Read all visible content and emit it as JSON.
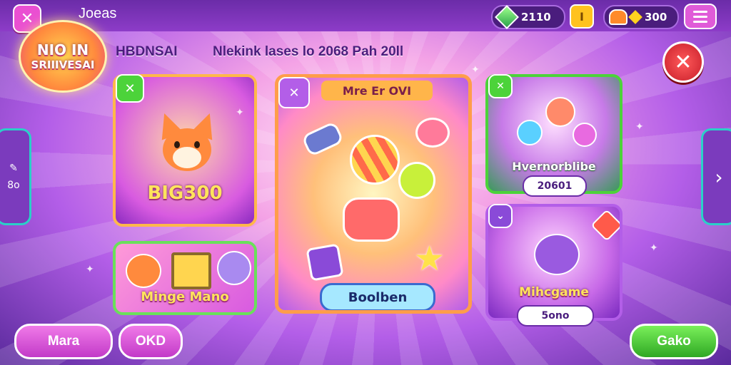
{
  "topbar": {
    "close_icon": "close-icon",
    "title": "Joeas",
    "gems_value": "2110",
    "coin_button_label": "I",
    "currency2_value": "300",
    "menu_icon": "hamburger-menu-icon"
  },
  "logo": {
    "line1": "NIO IN",
    "line2": "SRIIIVESAI"
  },
  "header": {
    "label": "HBDNSAI",
    "subtitle": "Nlekink lases lo 2068 Pah 20ll"
  },
  "cards": {
    "fox": {
      "label": "BIG300"
    },
    "featured": {
      "title": "Mre Er OVI",
      "button": "Boolben"
    },
    "adventure": {
      "label": "Hvernorblibe",
      "chip": "20601"
    },
    "minigame": {
      "label": "Minge Mano"
    },
    "cat": {
      "label": "Mihcgame",
      "chip": "5ono"
    }
  },
  "bottom": {
    "left1": "Mara",
    "left2": "OKD",
    "right": "Gako"
  },
  "side_left": {
    "line1": "8o"
  },
  "colors": {
    "accent": "#e05bd8",
    "green": "#4cd33a",
    "danger": "#e0252f",
    "purple": "#6b2ca8"
  }
}
